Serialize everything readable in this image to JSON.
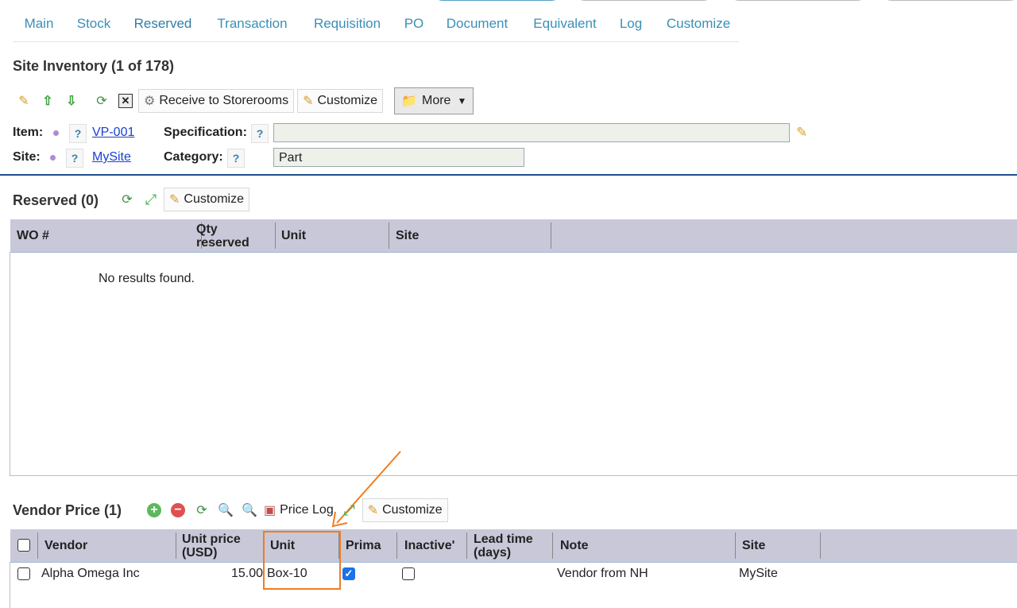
{
  "tabs": [
    "Main",
    "Stock",
    "Reserved",
    "Transaction",
    "Requisition",
    "PO",
    "Document",
    "Equivalent",
    "Log",
    "Customize"
  ],
  "active_tab": "Reserved",
  "site_inventory": {
    "title": "Site Inventory (1 of 178)",
    "toolbar": {
      "receive_label": "Receive to Storerooms",
      "customize_label": "Customize",
      "more_label": "More"
    },
    "item_label": "Item:",
    "item_value": "VP-001",
    "site_label": "Site:",
    "site_value": "MySite",
    "spec_label": "Specification:",
    "spec_value": "",
    "category_label": "Category:",
    "category_value": "Part",
    "help_glyph": "?"
  },
  "reserved": {
    "title": "Reserved (0)",
    "customize_label": "Customize",
    "columns": [
      "WO #",
      "Qty reserved",
      "Unit",
      "Site"
    ],
    "empty_text": "No results found."
  },
  "vendor_price": {
    "title": "Vendor Price (1)",
    "price_log_label": "Price Log",
    "customize_label": "Customize",
    "columns": [
      "Vendor",
      "Unit price (USD)",
      "Unit",
      "Prima",
      "Inactive'",
      "Lead time (days)",
      "Note",
      "Site"
    ],
    "rows": [
      {
        "vendor": "Alpha Omega Inc",
        "unit_price": "15.00",
        "unit": "Box-10",
        "primary": true,
        "inactive": false,
        "lead_time": "",
        "note": "Vendor from NH",
        "site": "MySite"
      }
    ]
  },
  "colors": {
    "tab_text": "#3a8fb7",
    "header_bg": "#c9c8d9",
    "accent_rule": "#1f4e8c",
    "callout": "#ef7d22",
    "link": "#1a3fd0",
    "checkbox_on": "#1a73e8"
  }
}
